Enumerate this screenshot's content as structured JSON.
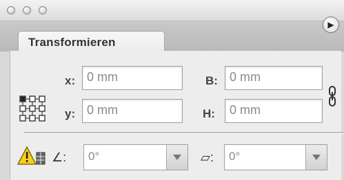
{
  "panel": {
    "tab_title": "Transformieren",
    "menu_glyph": "▶"
  },
  "fields": {
    "x": {
      "label": "x:",
      "value": "0 mm"
    },
    "y": {
      "label": "y:",
      "value": "0 mm"
    },
    "b": {
      "label": "B:",
      "value": "0 mm"
    },
    "h": {
      "label": "H:",
      "value": "0 mm"
    }
  },
  "bottom": {
    "rotate": {
      "value": "0°"
    },
    "shear": {
      "value": "0°"
    },
    "rotate_glyph": "∠:",
    "shear_glyph": "▱:"
  },
  "icons": {
    "reference_point": "reference-point-grid-icon",
    "link": "link-proportions-icon",
    "warning": "warning-icon",
    "window_buttons": "traffic-light-buttons"
  }
}
